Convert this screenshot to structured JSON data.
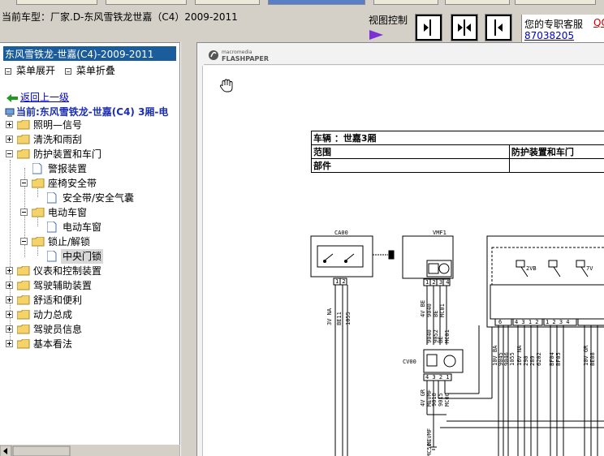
{
  "header": {
    "title": "当前车型：厂家.D-东风雪铁龙世嘉（C4）2009-2011",
    "view_control_label": "视图控制",
    "service_text": "您的专职客服",
    "service_link": "QQ",
    "service_phone": "87038205"
  },
  "sidebar": {
    "header": "东风雪铁龙-世嘉(C4)-2009-2011",
    "expand_label": "菜单展开",
    "collapse_label": "菜单折叠",
    "back_label": "返回上一级",
    "current_label": "当前:东风雪铁龙-世嘉(C4) 3厢-电",
    "tree": [
      {
        "label": "照明—信号"
      },
      {
        "label": "清洗和雨刮"
      },
      {
        "label": "防护装置和车门"
      },
      {
        "label": "警报装置"
      },
      {
        "label": "座椅安全带"
      },
      {
        "label": "安全带/安全气囊"
      },
      {
        "label": "电动车窗"
      },
      {
        "label": "电动车窗"
      },
      {
        "label": "锁止/解锁"
      },
      {
        "label": "中央门锁"
      },
      {
        "label": "仪表和控制装置"
      },
      {
        "label": "驾驶辅助装置"
      },
      {
        "label": "舒适和便利"
      },
      {
        "label": "动力总成"
      },
      {
        "label": "驾驶员信息"
      },
      {
        "label": "基本看法"
      }
    ]
  },
  "viewer": {
    "logo_brand": "macromedia",
    "logo_product": "FLASHPAPER",
    "table": {
      "vehicle": "车辆 ：世嘉3厢",
      "scope_label": "范围",
      "scope_value": "防护装置和车门",
      "part_label": "部件"
    },
    "schematic": {
      "labels": {
        "ca00": "CA00",
        "vmf1": "VMF1",
        "cv00": "CV00",
        "c_2vb": "2VB",
        "c_7v": "7V",
        "w_3vna": "3V NA",
        "w_be11": "BE11",
        "w_1055": "1055",
        "w_4vbe": "4V BE",
        "w_9040": "9040",
        "w_be": "BE",
        "w_mc01": "MC01",
        "w_9040b": "9040",
        "w_9052": "9052",
        "w_be2": "BE",
        "w_mc01b": "MC01",
        "w_4vgr": "4V GR",
        "w_mevmf": "MEVMF",
        "w_9018": "9018",
        "w_9015": "9015",
        "w_mc00": "MC00",
        "w_10vba": "10V BA",
        "w_9045": "9045",
        "w_9046": "9046",
        "w_1055b": "1055",
        "w_16vna": "16V NA",
        "w_290": "290",
        "w_289": "289",
        "w_6202": "6202",
        "w_bfo4": "BF04",
        "w_bfo5": "BF05",
        "w_10vgr": "10V GR",
        "w_be08": "BE08",
        "w_mevmf2": "MEVMF",
        "w_mc50": "MC50",
        "pins_12": "1 2",
        "pins_1234": "1 2 3 4",
        "pins_1234b": "1 2 3 4",
        "pins_4321": "4 3 2 1",
        "pins_6": "6",
        "pins_4312": "4 3 1 2"
      }
    }
  },
  "colors": {
    "selection": "#1a5c9c",
    "link": "#0000cc",
    "current": "#1c2fb0",
    "folder": "#f4d36a"
  }
}
